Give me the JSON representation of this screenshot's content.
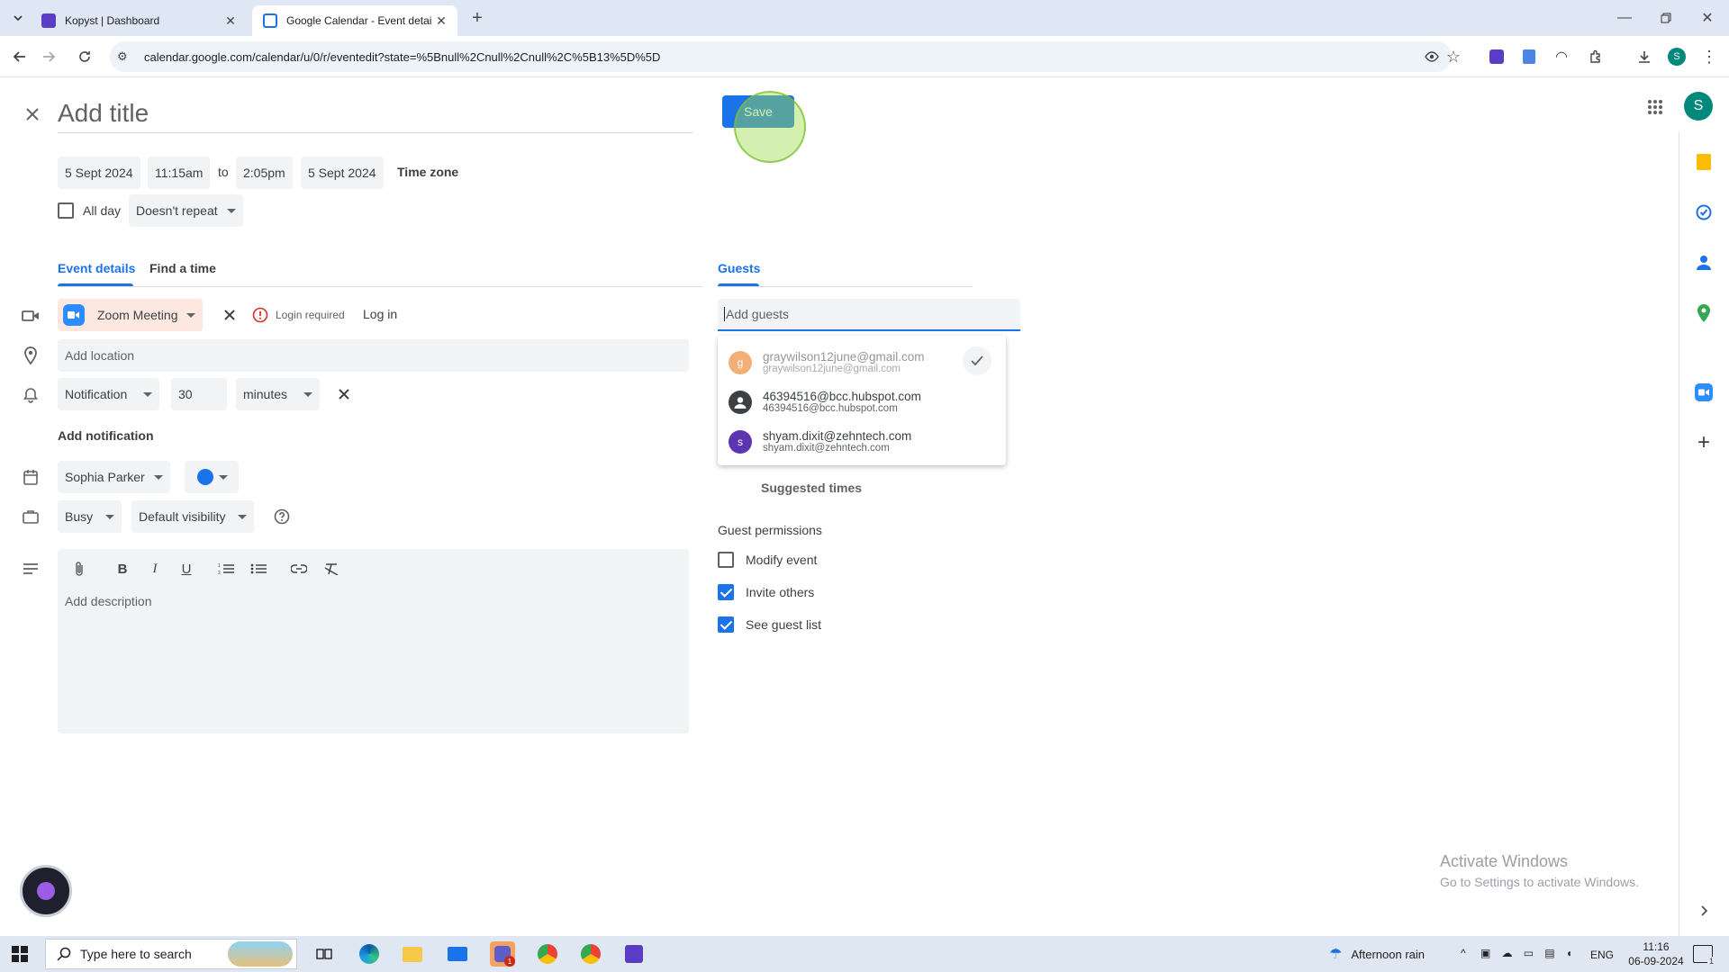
{
  "browser": {
    "tabs": [
      {
        "title": "Kopyst | Dashboard",
        "active": false
      },
      {
        "title": "Google Calendar - Event details",
        "active": true
      }
    ],
    "url": "calendar.google.com/calendar/u/0/r/eventedit?state=%5Bnull%2Cnull%2Cnull%2C%5B13%5D%5D",
    "profile_initial": "S"
  },
  "event": {
    "title_placeholder": "Add title",
    "save_label": "Save",
    "start_date": "5 Sept 2024",
    "start_time": "11:15am",
    "to_label": "to",
    "end_time": "2:05pm",
    "end_date": "5 Sept 2024",
    "time_zone_label": "Time zone",
    "all_day_label": "All day",
    "all_day_checked": false,
    "repeat": "Doesn't repeat"
  },
  "tabs": {
    "event_details": "Event details",
    "find_a_time": "Find a time",
    "guests": "Guests"
  },
  "details": {
    "conference": "Zoom Meeting",
    "login_required": "Login required",
    "log_in": "Log in",
    "location_placeholder": "Add location",
    "notification_type": "Notification",
    "notification_value": "30",
    "notification_unit": "minutes",
    "add_notification": "Add notification",
    "calendar_owner": "Sophia Parker",
    "calendar_color": "#1a73e8",
    "availability": "Busy",
    "visibility": "Default visibility",
    "description_placeholder": "Add description"
  },
  "guests": {
    "input_placeholder": "Add guests",
    "suggestions": [
      {
        "initial": "g",
        "name": "graywilson12june@gmail.com",
        "email": "graywilson12june@gmail.com",
        "color": "#e8710a",
        "added": true
      },
      {
        "initial": "",
        "name": "46394516@bcc.hubspot.com",
        "email": "46394516@bcc.hubspot.com",
        "color": "#5f6368",
        "added": false
      },
      {
        "initial": "s",
        "name": "shyam.dixit@zehntech.com",
        "email": "shyam.dixit@zehntech.com",
        "color": "#5e35b1",
        "added": false
      }
    ],
    "suggested_times": "Suggested times",
    "permissions_title": "Guest permissions",
    "permissions": [
      {
        "label": "Modify event",
        "checked": false
      },
      {
        "label": "Invite others",
        "checked": true
      },
      {
        "label": "See guest list",
        "checked": true
      }
    ]
  },
  "app": {
    "avatar_initial": "S",
    "avatar_color": "#00897b"
  },
  "watermark": {
    "line1": "Activate Windows",
    "line2": "Go to Settings to activate Windows."
  },
  "taskbar": {
    "search_placeholder": "Type here to search",
    "weather": "Afternoon rain",
    "language": "ENG",
    "time": "11:16",
    "date": "06-09-2024",
    "notification_count": "1",
    "teams_badge": "1"
  }
}
